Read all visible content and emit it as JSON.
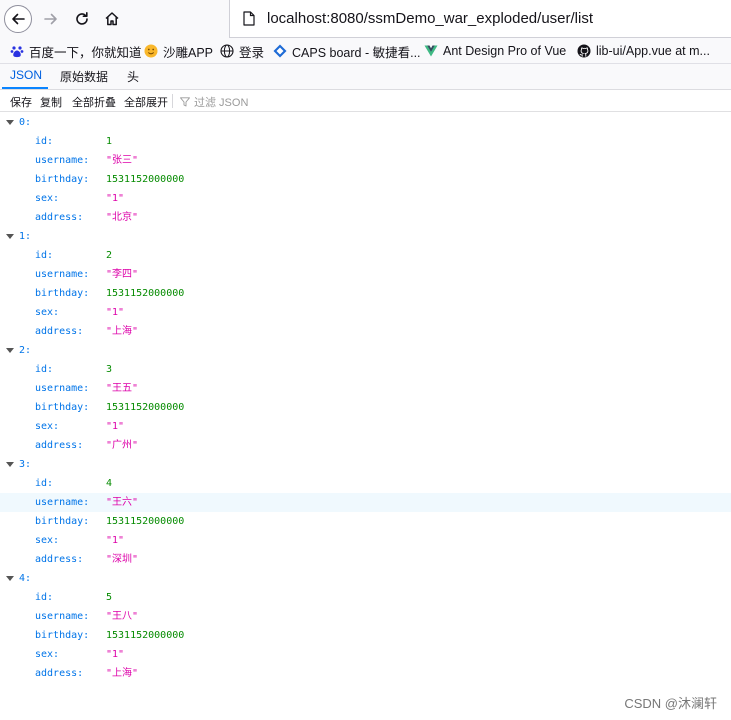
{
  "browser": {
    "url": "localhost:8080/ssmDemo_war_exploded/user/list"
  },
  "bookmarks": [
    {
      "label": "百度一下，你就知道",
      "icon": "baidu-icon"
    },
    {
      "label": "沙雕APP",
      "icon": "smiley-icon"
    },
    {
      "label": "登录",
      "icon": "globe-icon"
    },
    {
      "label": "CAPS board - 敏捷看...",
      "icon": "caps-icon"
    },
    {
      "label": "Ant Design Pro of Vue",
      "icon": "vue-icon"
    },
    {
      "label": "lib-ui/App.vue at m...",
      "icon": "github-icon"
    }
  ],
  "viewer": {
    "tabs": [
      "JSON",
      "原始数据",
      "头"
    ],
    "toolbar": [
      "保存",
      "复制",
      "全部折叠",
      "全部展开"
    ],
    "filter_placeholder": "过滤 JSON"
  },
  "records": [
    {
      "index": "0:",
      "id": "1",
      "username": "\"张三\"",
      "birthday": "1531152000000",
      "sex": "\"1\"",
      "address": "\"北京\""
    },
    {
      "index": "1:",
      "id": "2",
      "username": "\"李四\"",
      "birthday": "1531152000000",
      "sex": "\"1\"",
      "address": "\"上海\""
    },
    {
      "index": "2:",
      "id": "3",
      "username": "\"王五\"",
      "birthday": "1531152000000",
      "sex": "\"1\"",
      "address": "\"广州\""
    },
    {
      "index": "3:",
      "id": "4",
      "username": "\"王六\"",
      "birthday": "1531152000000",
      "sex": "\"1\"",
      "address": "\"深圳\""
    },
    {
      "index": "4:",
      "id": "5",
      "username": "\"王八\"",
      "birthday": "1531152000000",
      "sex": "\"1\"",
      "address": "\"上海\""
    }
  ],
  "field_labels": {
    "id": "id:",
    "username": "username:",
    "birthday": "birthday:",
    "sex": "sex:",
    "address": "address:"
  },
  "watermark": "CSDN @沐澜轩",
  "colors": {
    "key": "#0074e8",
    "number": "#058b00",
    "string": "#dd00a9",
    "highlight_row": "#f0f9fe"
  }
}
